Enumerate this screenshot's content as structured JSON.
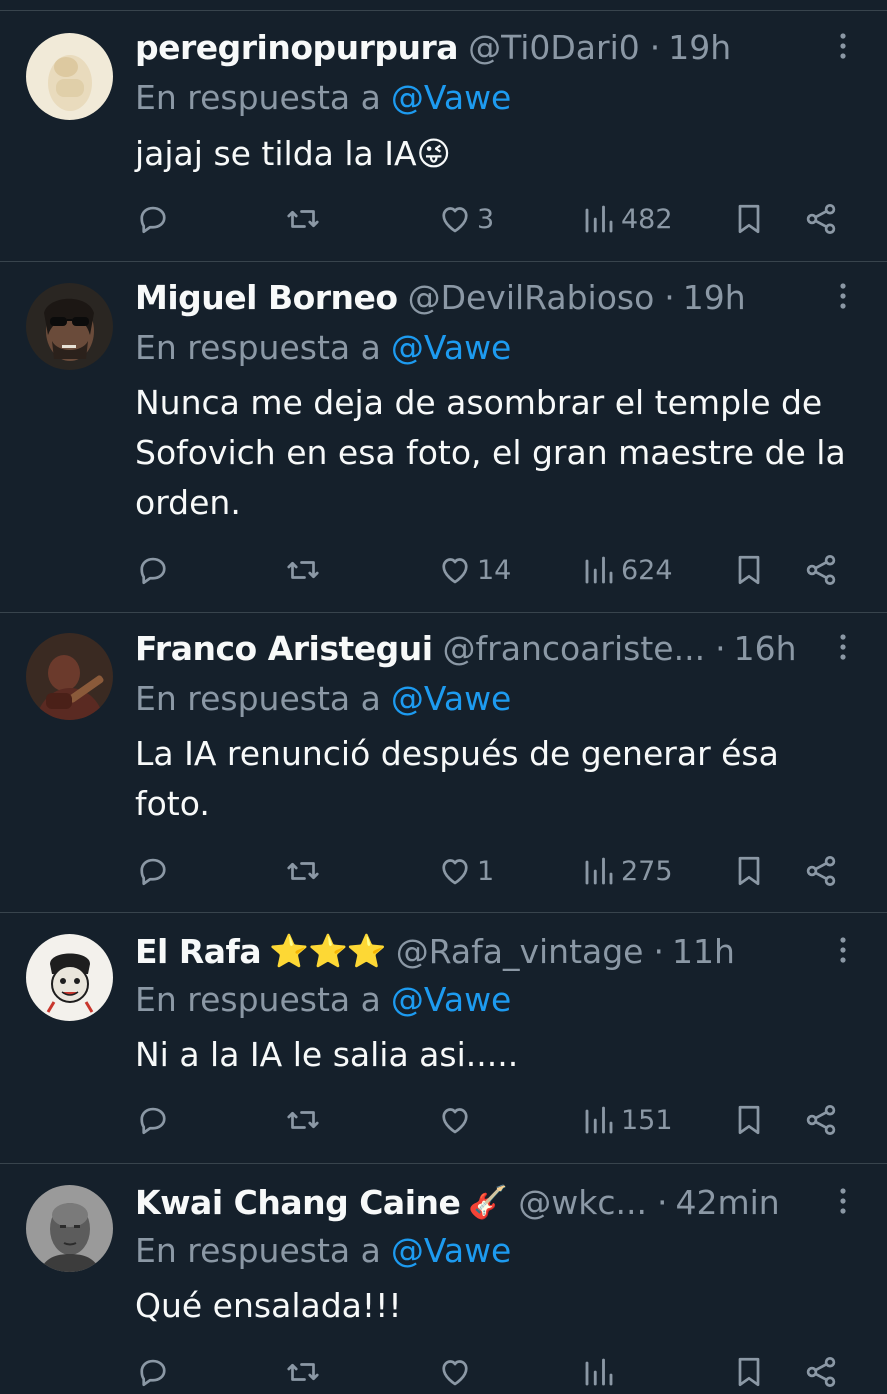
{
  "colors": {
    "background": "#15202b",
    "text": "#f7f9f9",
    "secondary": "#8b98a5",
    "link": "#1d9bf0",
    "divider": "#38444d"
  },
  "reply_prefix": "En respuesta a",
  "separator": "·",
  "tweets": [
    {
      "name": "peregrinopurpura",
      "name_emoji": "",
      "handle": "@Ti0Dari0",
      "time": "19h",
      "mention": "@Vawe",
      "text": "jajaj se tilda la IA😜",
      "replies": "",
      "retweets": "",
      "likes": "3",
      "views": "482",
      "avatar_icon": "avatar-photo-icon"
    },
    {
      "name": "Miguel Borneo",
      "name_emoji": "",
      "handle": "@DevilRabioso",
      "time": "19h",
      "mention": "@Vawe",
      "text": "Nunca me deja de asombrar el temple de Sofovich en esa foto, el gran maestre de la orden.",
      "replies": "",
      "retweets": "",
      "likes": "14",
      "views": "624",
      "avatar_icon": "avatar-photo-icon"
    },
    {
      "name": "Franco Aristegui",
      "name_emoji": "",
      "handle": "@francoariste...",
      "time": "16h",
      "mention": "@Vawe",
      "text": "La IA renunció después de generar ésa foto.",
      "replies": "",
      "retweets": "",
      "likes": "1",
      "views": "275",
      "avatar_icon": "avatar-photo-icon"
    },
    {
      "name": "El Rafa",
      "name_emoji": "⭐⭐⭐",
      "handle": "@Rafa_vintage",
      "time": "11h",
      "mention": "@Vawe",
      "text": "Ni a la IA le salia asi.....",
      "replies": "",
      "retweets": "",
      "likes": "",
      "views": "151",
      "avatar_icon": "avatar-illustration-icon"
    },
    {
      "name": "Kwai Chang Caine",
      "name_emoji": "🎸",
      "handle": "@wkc...",
      "time": "42min",
      "mention": "@Vawe",
      "text": "Qué ensalada!!!",
      "replies": "",
      "retweets": "",
      "likes": "",
      "views": "",
      "avatar_icon": "avatar-photo-icon"
    }
  ]
}
